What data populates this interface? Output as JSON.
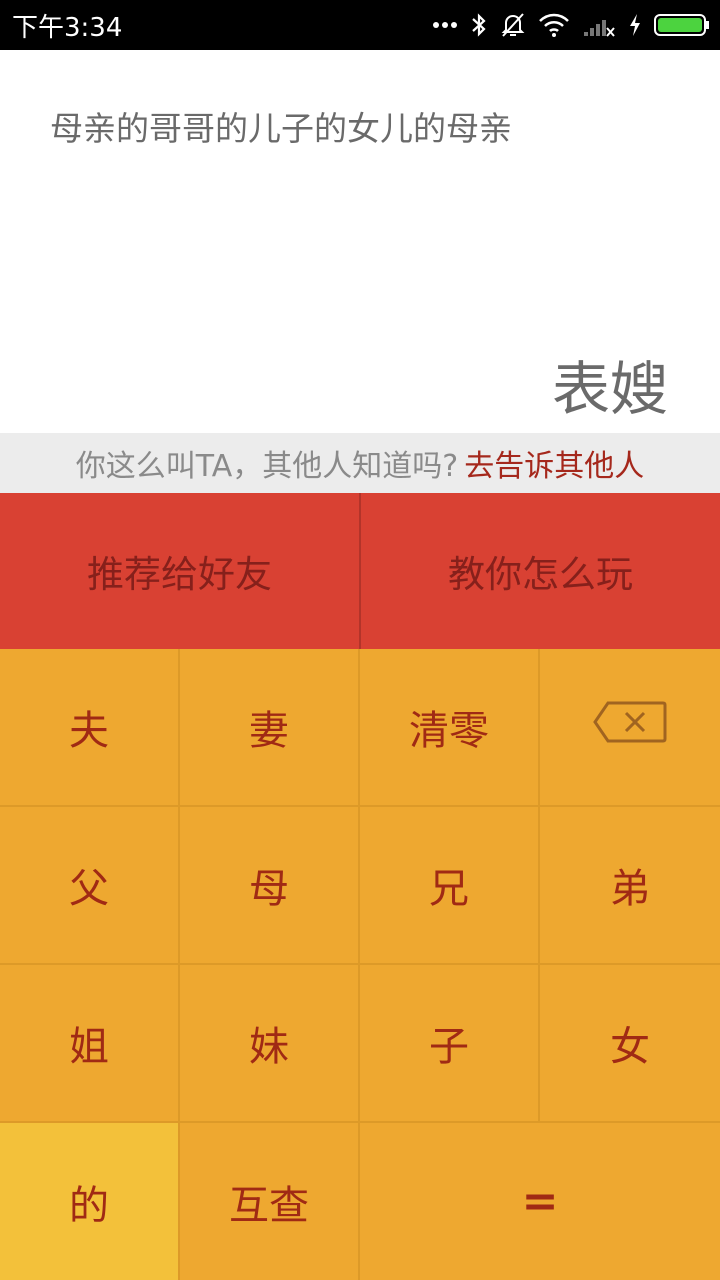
{
  "status_bar": {
    "time": "下午3:34",
    "icons": [
      "more-dots-icon",
      "bluetooth-icon",
      "bell-muted-icon",
      "wifi-icon",
      "signal-off-icon",
      "charging-icon",
      "battery-icon"
    ]
  },
  "display": {
    "expression": "母亲的哥哥的儿子的女儿的母亲",
    "result": "表嫂"
  },
  "share": {
    "question": "你这么叫TA，其他人知道吗?",
    "link": "去告诉其他人"
  },
  "actions": {
    "recommend": "推荐给好友",
    "tutorial": "教你怎么玩"
  },
  "keys": {
    "husband": "夫",
    "wife": "妻",
    "clear": "清零",
    "father": "父",
    "mother": "母",
    "elder_brother": "兄",
    "younger_brother": "弟",
    "elder_sister": "姐",
    "younger_sister": "妹",
    "son": "子",
    "daughter": "女",
    "of": "的",
    "mutual": "互查",
    "equals": "="
  },
  "colors": {
    "action_bg": "#d94133",
    "keypad_bg": "#eea830",
    "key_highlight": "#f3c13a",
    "key_text": "#a02a14",
    "link_text": "#a5281c"
  }
}
